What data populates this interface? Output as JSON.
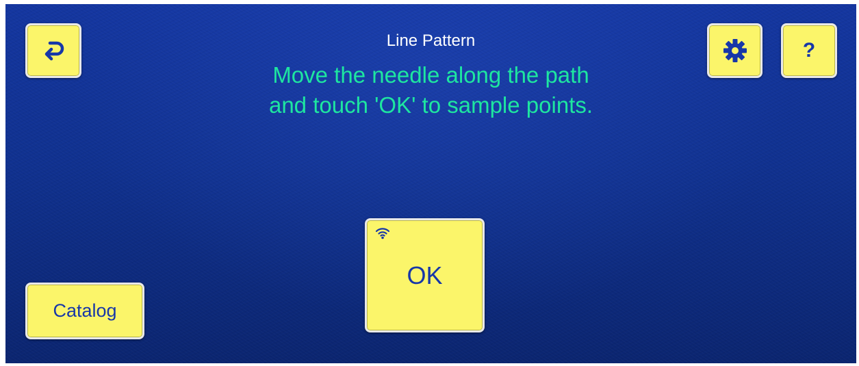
{
  "header": {
    "title": "Line Pattern",
    "instruction_line1": "Move the needle along the path",
    "instruction_line2": "and touch 'OK' to sample points."
  },
  "buttons": {
    "back_icon": "return-arrow-icon",
    "settings_icon": "gear-icon",
    "help_label": "?",
    "catalog_label": "Catalog",
    "ok_label": "OK",
    "ok_badge_icon": "wifi-icon"
  },
  "colors": {
    "background": "#10318f",
    "button_fill": "#fbf56a",
    "button_text": "#1737a8",
    "title_text": "#ffffff",
    "instruction_text": "#1ee6a0"
  }
}
